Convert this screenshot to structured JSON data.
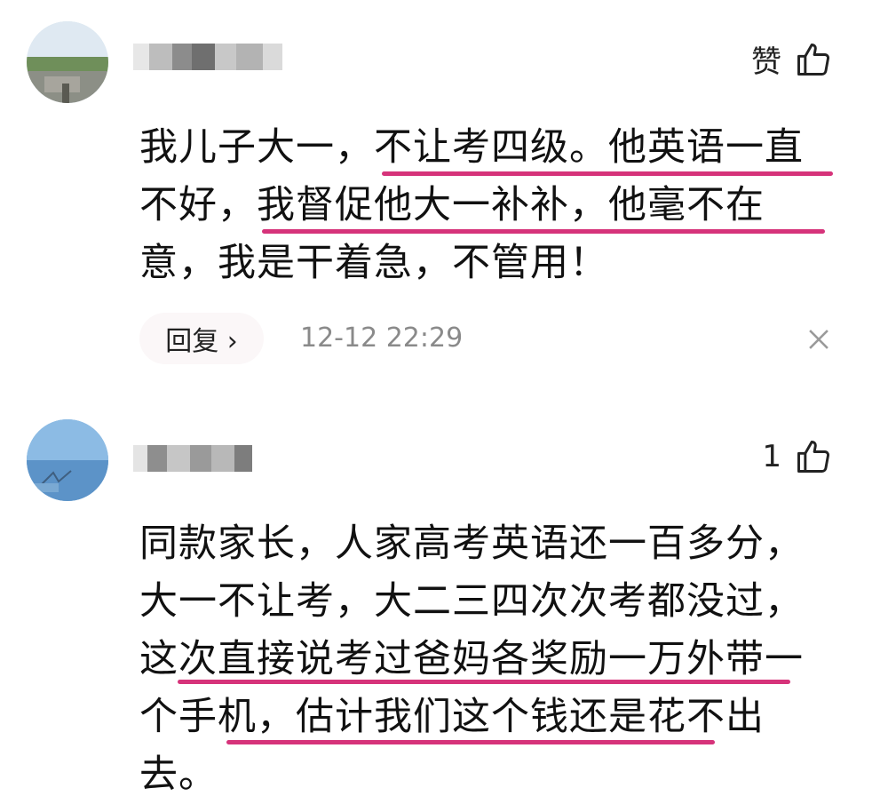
{
  "comments": [
    {
      "like_label": "赞",
      "like_count": "",
      "lines": [
        "我儿子大一，不让考四级。他英语一直",
        "不好，我督促他大一补补，他毫不在",
        "意，我是干着急，不管用！"
      ],
      "reply_label": "回复 ›",
      "timestamp": "12-12 22:29"
    },
    {
      "like_label": "",
      "like_count": "1",
      "lines": [
        "同款家长，人家高考英语还一百多分，",
        "大一不让考，大二三四次次考都没过，",
        "这次直接说考过爸妈各奖励一万外带一",
        "个手机，估计我们这个钱还是花不出",
        "去。"
      ]
    }
  ],
  "colors": {
    "underline": "#d6337a",
    "timestamp": "#8a8a8a"
  },
  "icons": [
    "thumbs-up-icon",
    "close-icon",
    "chevron-right-icon"
  ]
}
